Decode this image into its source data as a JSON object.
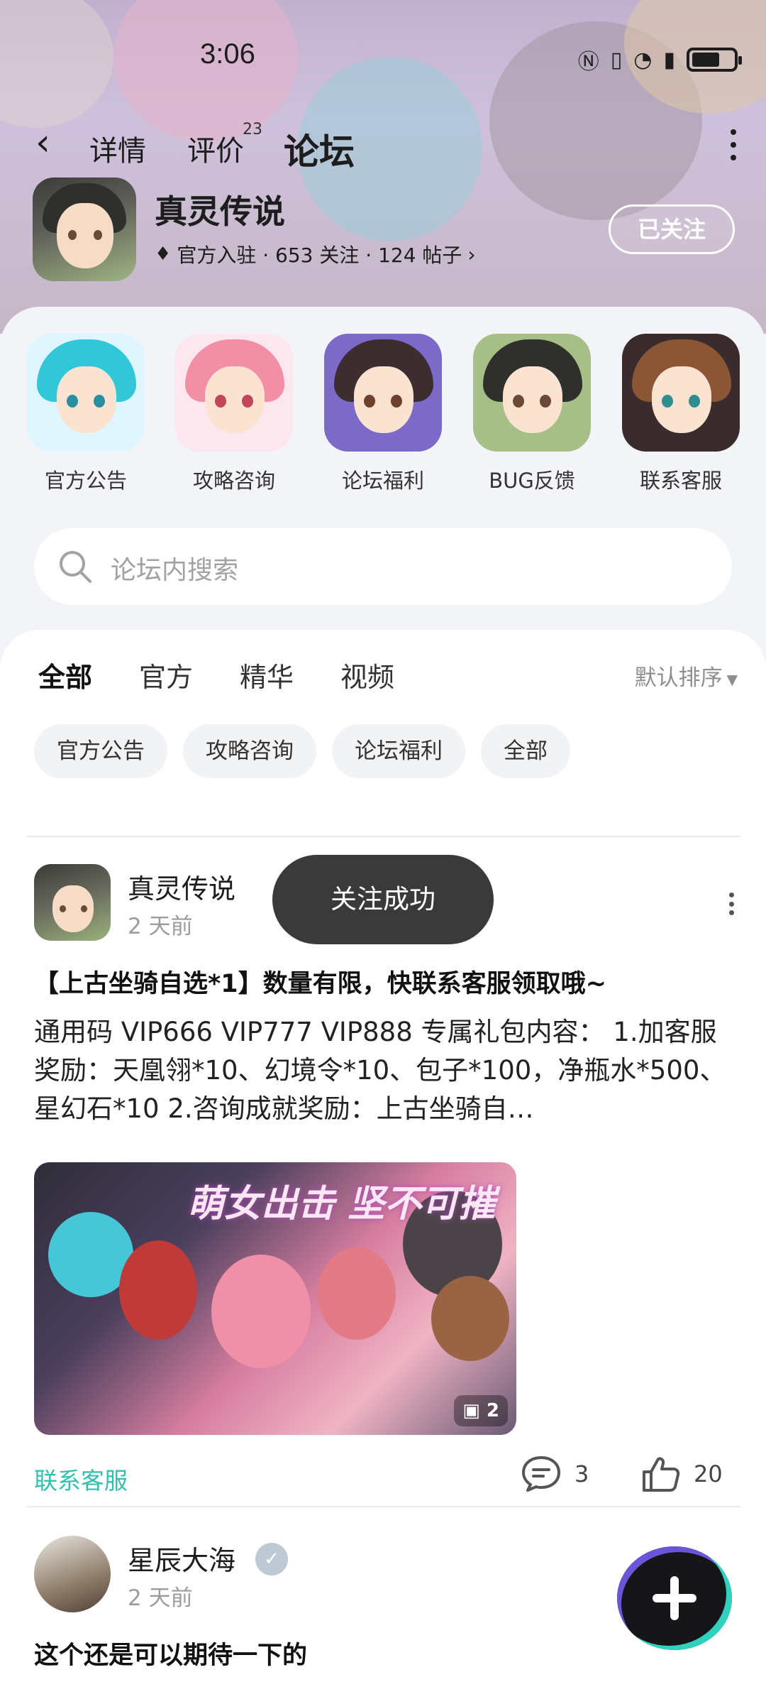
{
  "status_bar": {
    "time": "3:06",
    "icons": [
      "nfc-icon",
      "vibrate-icon",
      "wifi-icon",
      "sim-icon",
      "battery-icon"
    ]
  },
  "nav": {
    "tabs": [
      {
        "label": "详情"
      },
      {
        "label": "评价",
        "badge": "23"
      },
      {
        "label": "论坛"
      }
    ],
    "active_tab": "论坛"
  },
  "game": {
    "title": "真灵传说",
    "meta": "官方入驻 · 653 关注 · 124 帖子",
    "follow_label": "已关注"
  },
  "quick_links": [
    {
      "label": "官方公告",
      "hair": "#31c7d8",
      "eye": "#2a8da0",
      "bg": "#dff5ff"
    },
    {
      "label": "攻略咨询",
      "hair": "#f28fa6",
      "eye": "#c2455a",
      "bg": "#fde7ee"
    },
    {
      "label": "论坛福利",
      "hair": "#3d2d30",
      "eye": "#6e3f2c",
      "bg": "#7b6ac7"
    },
    {
      "label": "BUG反馈",
      "hair": "#2f302b",
      "eye": "#6a4a35",
      "bg": "#a5bf86"
    },
    {
      "label": "联系客服",
      "hair": "#8b5636",
      "eye": "#2f8c8f",
      "bg": "#3a2c2c"
    }
  ],
  "search": {
    "placeholder": "论坛内搜索"
  },
  "feed_tabs": [
    "全部",
    "官方",
    "精华",
    "视频"
  ],
  "sort_label": "默认排序",
  "filter_chips": [
    "官方公告",
    "攻略咨询",
    "论坛福利",
    "全部"
  ],
  "posts": [
    {
      "author": "真灵传说",
      "time": "2 天前",
      "title": "【上古坐骑自选*1】数量有限，快联系客服领取哦~",
      "body": "通用码 VIP666 VIP777 VIP888 专属礼包内容： 1.加客服奖励：天凰翎*10、幻境令*10、包子*100，净瓶水*500、星幻石*10 2.咨询成就奖励：上古坐骑自…",
      "image_banner": "萌女出击 坚不可摧",
      "image_count": "2",
      "contact_label": "联系客服",
      "comments": "3",
      "likes": "20"
    },
    {
      "author": "星辰大海",
      "time": "2 天前",
      "title": "这个还是可以期待一下的"
    }
  ],
  "toast": "关注成功"
}
